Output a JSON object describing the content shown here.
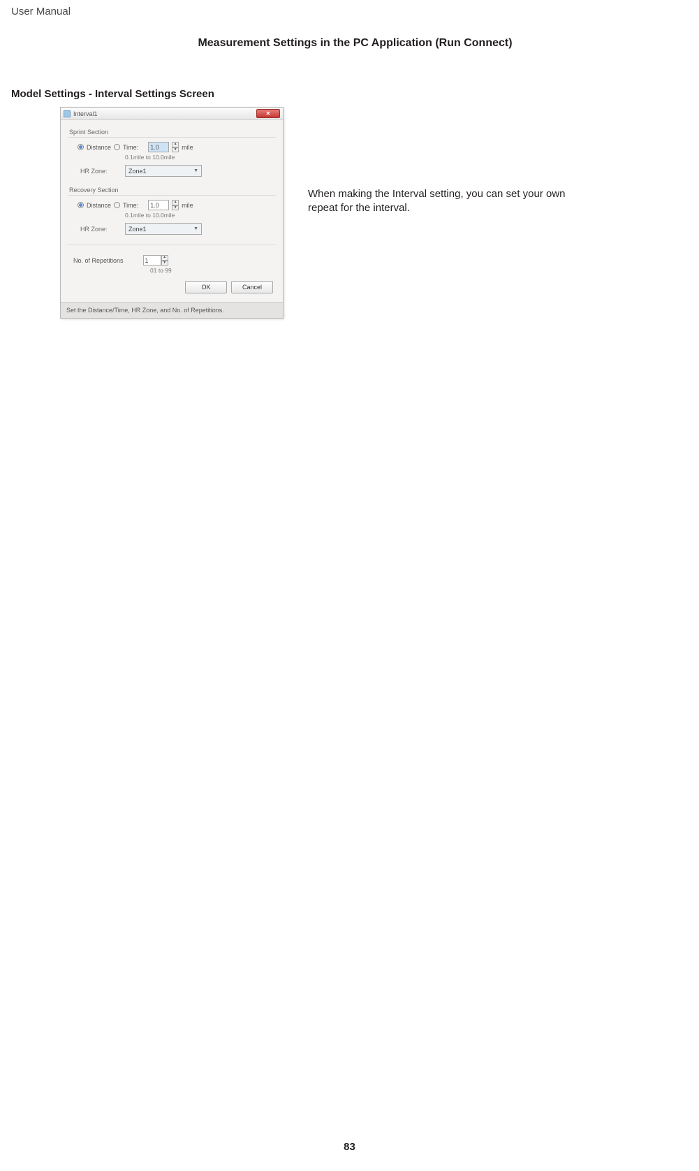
{
  "header": {
    "doc_type": "User Manual",
    "section_title": "Measurement Settings in the PC Application (Run Connect)",
    "sub_title": "Model Settings - Interval Settings Screen"
  },
  "dialog": {
    "title": "Interval1",
    "sprint": {
      "group": "Sprint Section",
      "distance_label": "Distance",
      "time_label": "Time:",
      "value": "1.0",
      "unit": "mile",
      "hint": "0.1mile to 10.0mile",
      "hr_label": "HR Zone:",
      "hr_value": "Zone1"
    },
    "recovery": {
      "group": "Recovery Section",
      "distance_label": "Distance",
      "time_label": "Time:",
      "value": "1.0",
      "unit": "mile",
      "hint": "0.1mile to 10.0mile",
      "hr_label": "HR Zone:",
      "hr_value": "Zone1"
    },
    "reps": {
      "label": "No. of Repetitions",
      "value": "1",
      "hint": "01 to 99"
    },
    "buttons": {
      "ok": "OK",
      "cancel": "Cancel"
    },
    "footer": "Set the Distance/Time, HR Zone, and No. of Repetitions."
  },
  "description": {
    "line1": "When making the Interval setting, you can set your own",
    "line2": "repeat for the interval."
  },
  "page_number": "83"
}
